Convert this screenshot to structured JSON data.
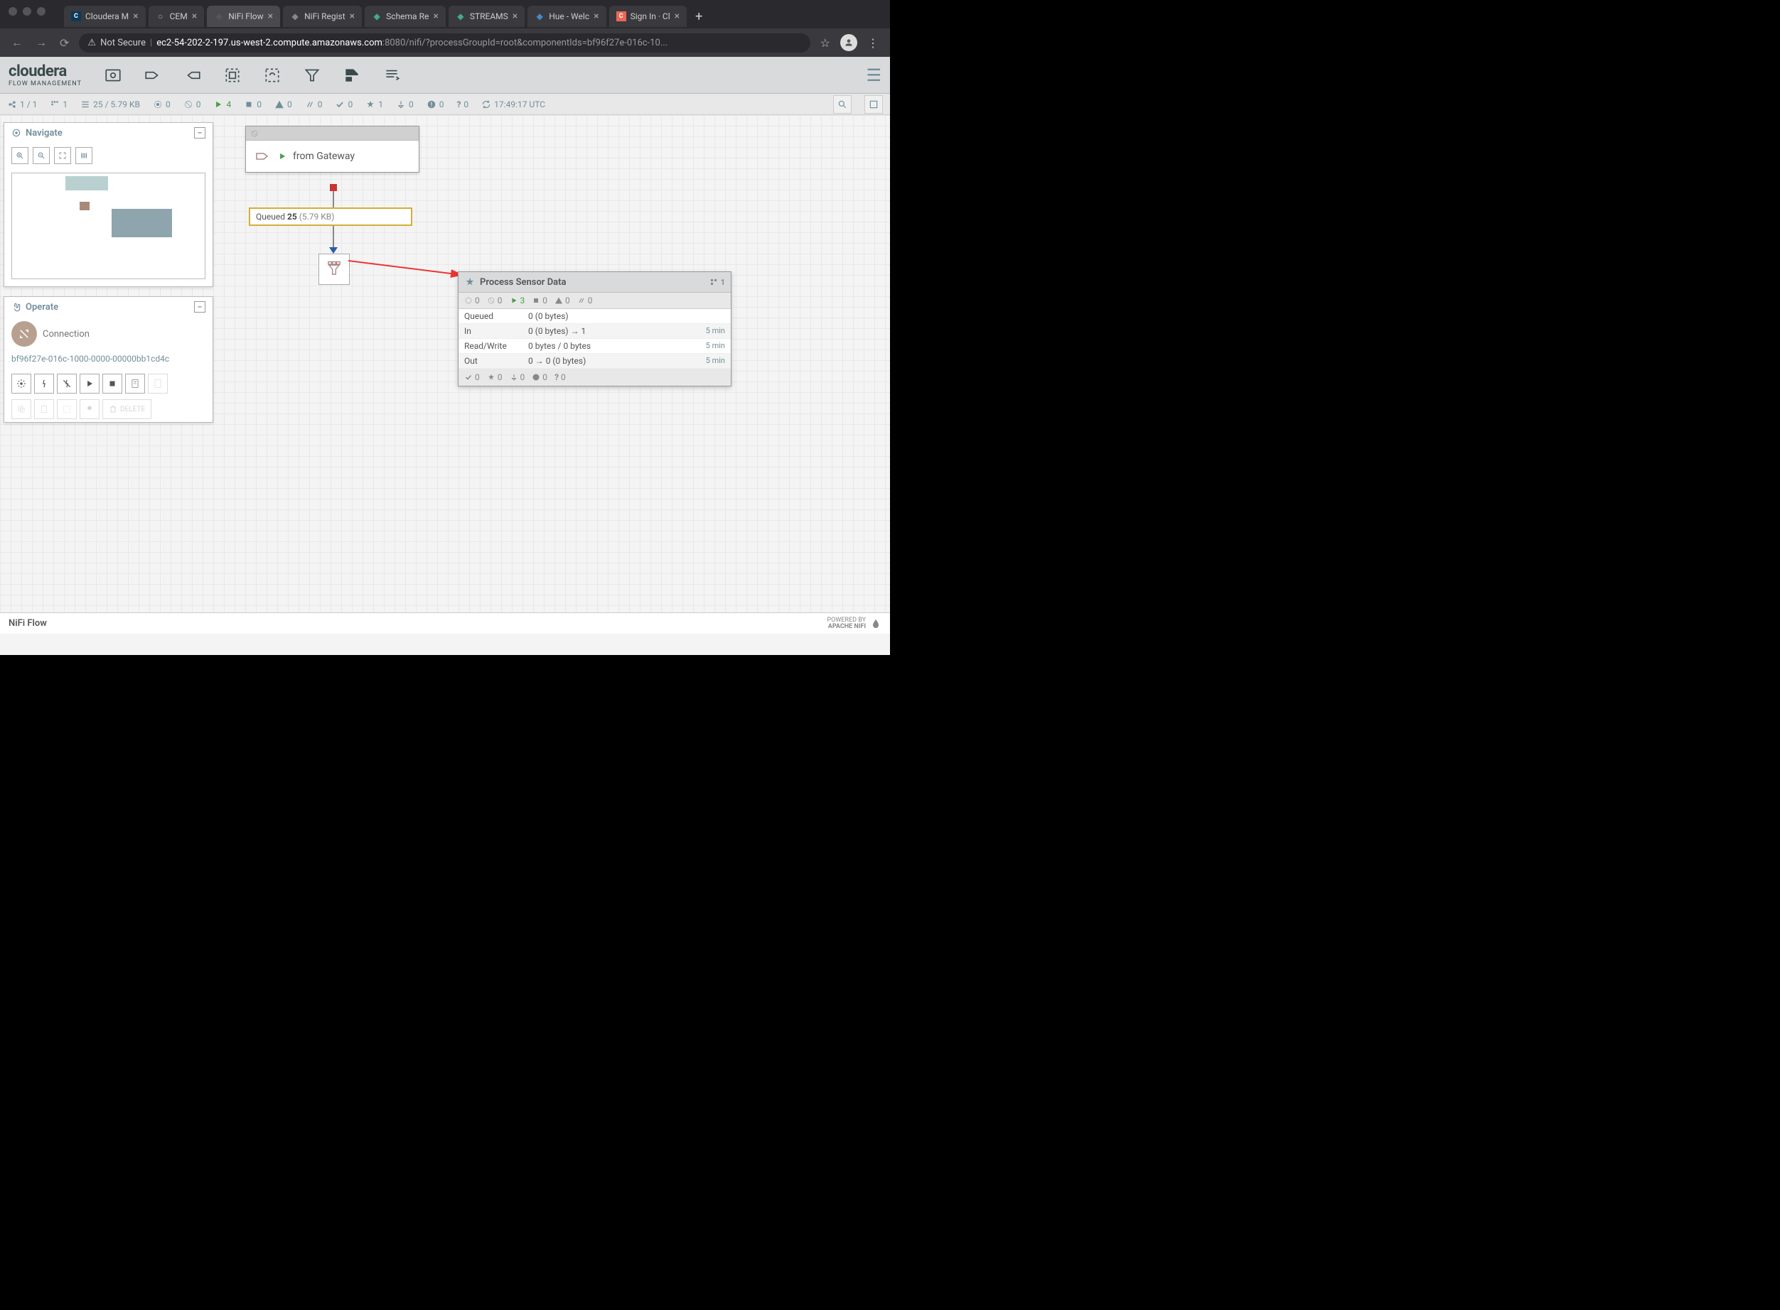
{
  "browser": {
    "tabs": [
      {
        "title": "Cloudera M",
        "icon": "C",
        "icon_bg": "#0a3a5a"
      },
      {
        "title": "CEM",
        "icon": "○",
        "icon_bg": "transparent"
      },
      {
        "title": "NiFi Flow",
        "icon": "◆",
        "icon_bg": "transparent",
        "active": true
      },
      {
        "title": "NiFi Regist",
        "icon": "◆",
        "icon_bg": "transparent"
      },
      {
        "title": "Schema Re",
        "icon": "◆",
        "icon_bg": "#4a8"
      },
      {
        "title": "STREAMS",
        "icon": "◆",
        "icon_bg": "#4a8"
      },
      {
        "title": "Hue - Welc",
        "icon": "◆",
        "icon_bg": "#48c"
      },
      {
        "title": "Sign In · Cl",
        "icon": "C",
        "icon_bg": "#e65"
      }
    ],
    "security": "Not Secure",
    "url_host": "ec2-54-202-2-197.us-west-2.compute.amazonaws.com",
    "url_port": ":8080",
    "url_path": "/nifi/?processGroupId=root&componentIds=bf96f27e-016c-10..."
  },
  "header": {
    "logo": "cloudera",
    "logo_sub": "FLOW MANAGEMENT"
  },
  "status": {
    "groups": "1 / 1",
    "threads": "1",
    "queued": "25 / 5.79 KB",
    "transmitting": "0",
    "not_transmitting": "0",
    "running": "4",
    "stopped": "0",
    "invalid": "0",
    "disabled": "0",
    "up_to_date": "0",
    "locally_modified": "1",
    "stale": "0",
    "sync_failure": "0",
    "unknown": "0",
    "refresh_time": "17:49:17 UTC"
  },
  "panels": {
    "navigate": {
      "title": "Navigate"
    },
    "operate": {
      "title": "Operate",
      "component_type": "Connection",
      "component_id": "bf96f27e-016c-1000-0000-00000bb1cd4c",
      "delete_label": "DELETE"
    }
  },
  "flow": {
    "input_port": {
      "name": "from Gateway"
    },
    "queue": {
      "label": "Queued",
      "count": "25",
      "size": "(5.79 KB)"
    },
    "process_group": {
      "name": "Process Sensor Data",
      "version": "1",
      "counts": {
        "transmitting": "0",
        "not_transmitting": "0",
        "running": "3",
        "stopped": "0",
        "invalid": "0",
        "disabled": "0"
      },
      "stats": {
        "queued": {
          "label": "Queued",
          "value": "0 (0 bytes)"
        },
        "in": {
          "label": "In",
          "value": "0 (0 bytes) → 1",
          "time": "5 min"
        },
        "rw": {
          "label": "Read/Write",
          "value": "0 bytes / 0 bytes",
          "time": "5 min"
        },
        "out": {
          "label": "Out",
          "value": "0 → 0 (0 bytes)",
          "time": "5 min"
        }
      },
      "footer": {
        "up_to_date": "0",
        "modified": "0",
        "stale": "0",
        "sync_fail": "0",
        "unknown": "0"
      }
    }
  },
  "breadcrumb": "NiFi Flow",
  "powered_by": {
    "line1": "POWERED BY",
    "line2": "APACHE NIFI"
  }
}
